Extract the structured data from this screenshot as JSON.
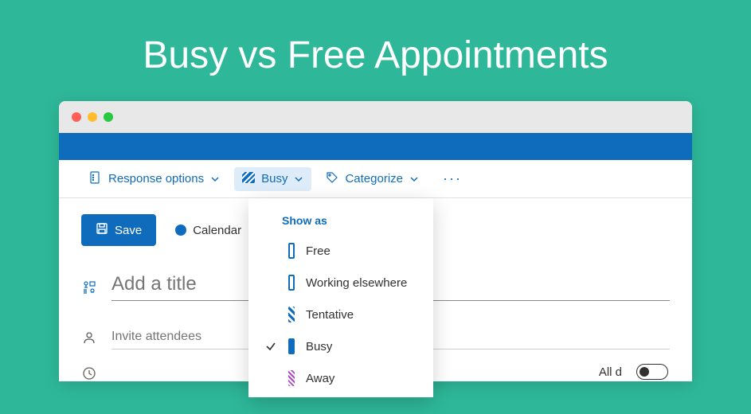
{
  "page": {
    "title": "Busy vs Free Appointments"
  },
  "toolbar": {
    "response_options": "Response options",
    "busy": "Busy",
    "categorize": "Categorize"
  },
  "actions": {
    "save": "Save"
  },
  "calendar": {
    "label": "Calendar"
  },
  "fields": {
    "title_placeholder": "Add a title",
    "attendees_placeholder": "Invite attendees",
    "allday_label": "All d"
  },
  "dropdown": {
    "header": "Show as",
    "items": [
      {
        "label": "Free",
        "selected": false,
        "swatch": "sw-free"
      },
      {
        "label": "Working elsewhere",
        "selected": false,
        "swatch": "sw-else"
      },
      {
        "label": "Tentative",
        "selected": false,
        "swatch": "sw-tent"
      },
      {
        "label": "Busy",
        "selected": true,
        "swatch": "sw-busy"
      },
      {
        "label": "Away",
        "selected": false,
        "swatch": "sw-away"
      }
    ]
  }
}
